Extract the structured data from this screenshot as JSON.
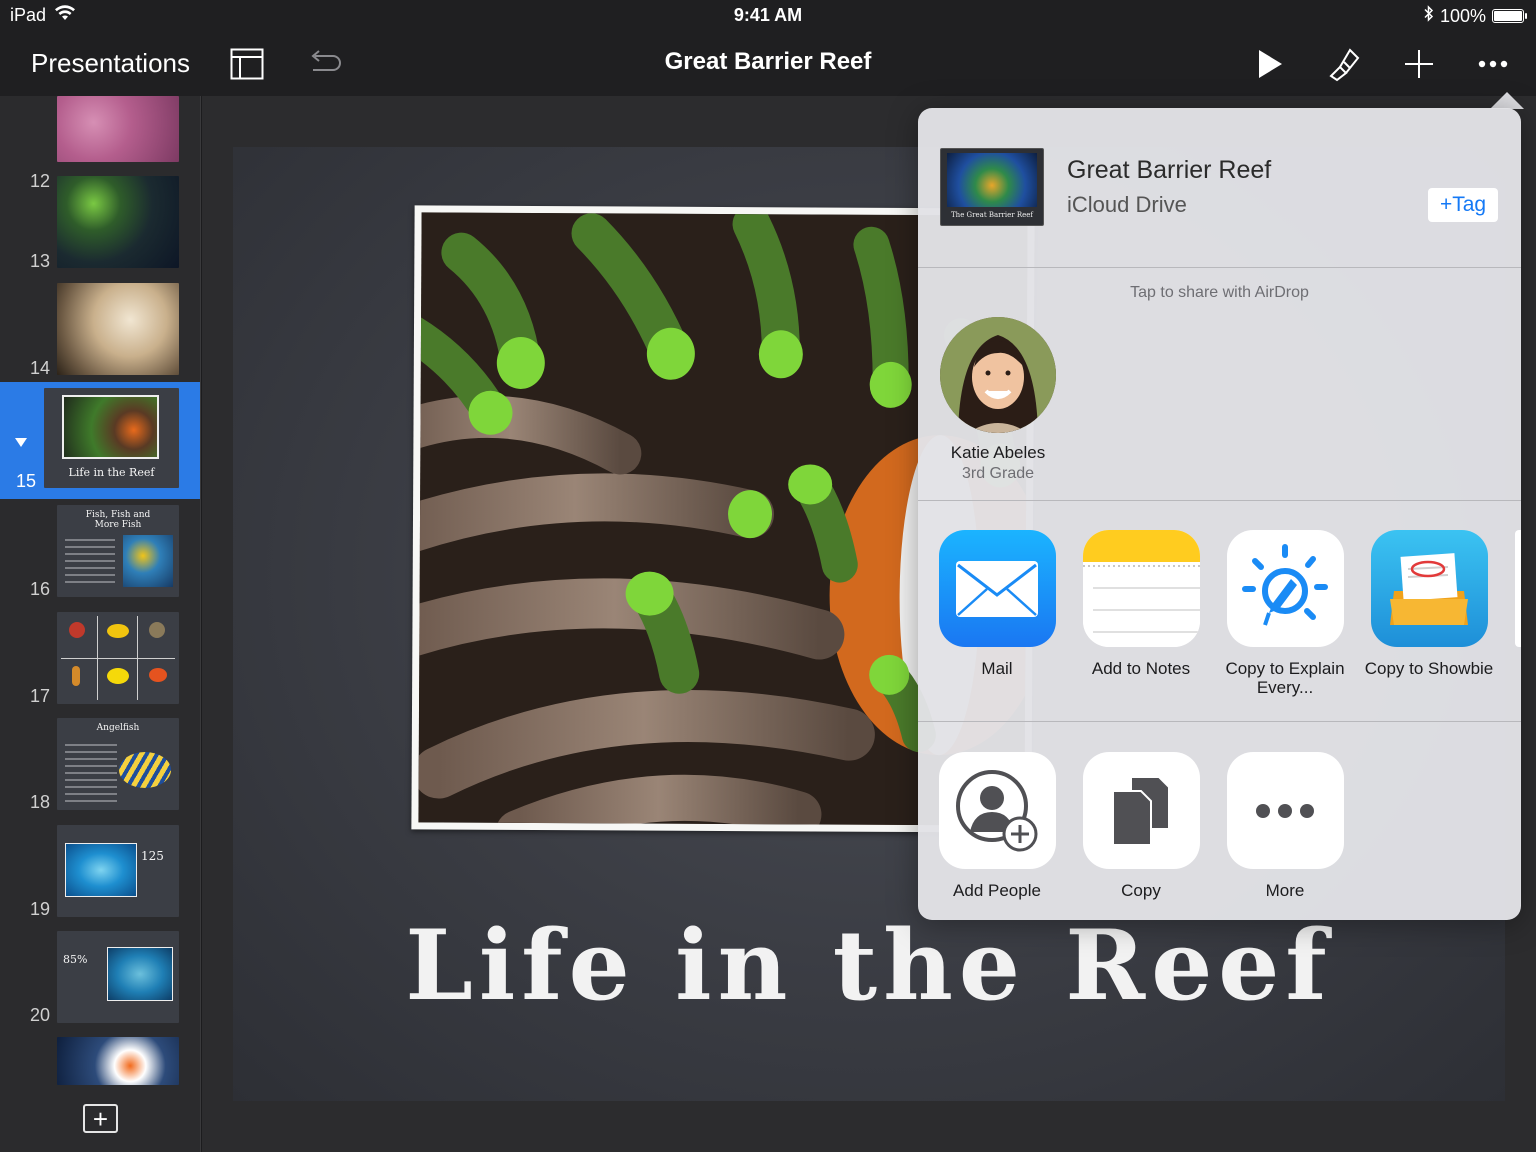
{
  "status": {
    "device": "iPad",
    "time": "9:41 AM",
    "battery": "100%"
  },
  "toolbar": {
    "back_label": "Presentations",
    "title": "Great Barrier Reef",
    "icons": [
      "slide-navigator-icon",
      "undo-icon",
      "play-icon",
      "format-brush-icon",
      "add-icon",
      "more-icon"
    ]
  },
  "sidebar": {
    "slides": [
      {
        "number": "12",
        "text": ""
      },
      {
        "number": "13",
        "text": ""
      },
      {
        "number": "14",
        "text": ""
      },
      {
        "number": "15",
        "text": "Life in the Reef",
        "selected": true
      },
      {
        "number": "16",
        "text": "Fish, Fish and More Fish"
      },
      {
        "number": "17",
        "text": ""
      },
      {
        "number": "18",
        "text": "Angelfish"
      },
      {
        "number": "19",
        "text": "125"
      },
      {
        "number": "20",
        "text": "85%"
      },
      {
        "number": "",
        "text": ""
      }
    ],
    "add_slide": "+"
  },
  "slide": {
    "title": "Life in the Reef"
  },
  "share": {
    "doc_title": "Great Barrier Reef",
    "doc_location": "iCloud Drive",
    "doc_thumb_caption": "The Great Barrier Reef",
    "tag_button": "+Tag",
    "airdrop_hint": "Tap to share with AirDrop",
    "airdrop_people": [
      {
        "name": "Katie Abeles",
        "subtitle": "3rd Grade"
      }
    ],
    "apps": [
      {
        "label": "Mail",
        "icon": "mail-icon",
        "color": "#1a8bf5"
      },
      {
        "label": "Add to Notes",
        "icon": "notes-icon",
        "color": "#ffd426"
      },
      {
        "label": "Copy to Explain Every...",
        "icon": "explain-everything-icon",
        "color": "#1a8bf5"
      },
      {
        "label": "Copy to Showbie",
        "icon": "showbie-icon",
        "color": "#2aa6e8"
      }
    ],
    "actions": [
      {
        "label": "Add People",
        "icon": "add-people-icon"
      },
      {
        "label": "Copy",
        "icon": "copy-icon"
      },
      {
        "label": "More",
        "icon": "more-dots-icon"
      }
    ]
  }
}
